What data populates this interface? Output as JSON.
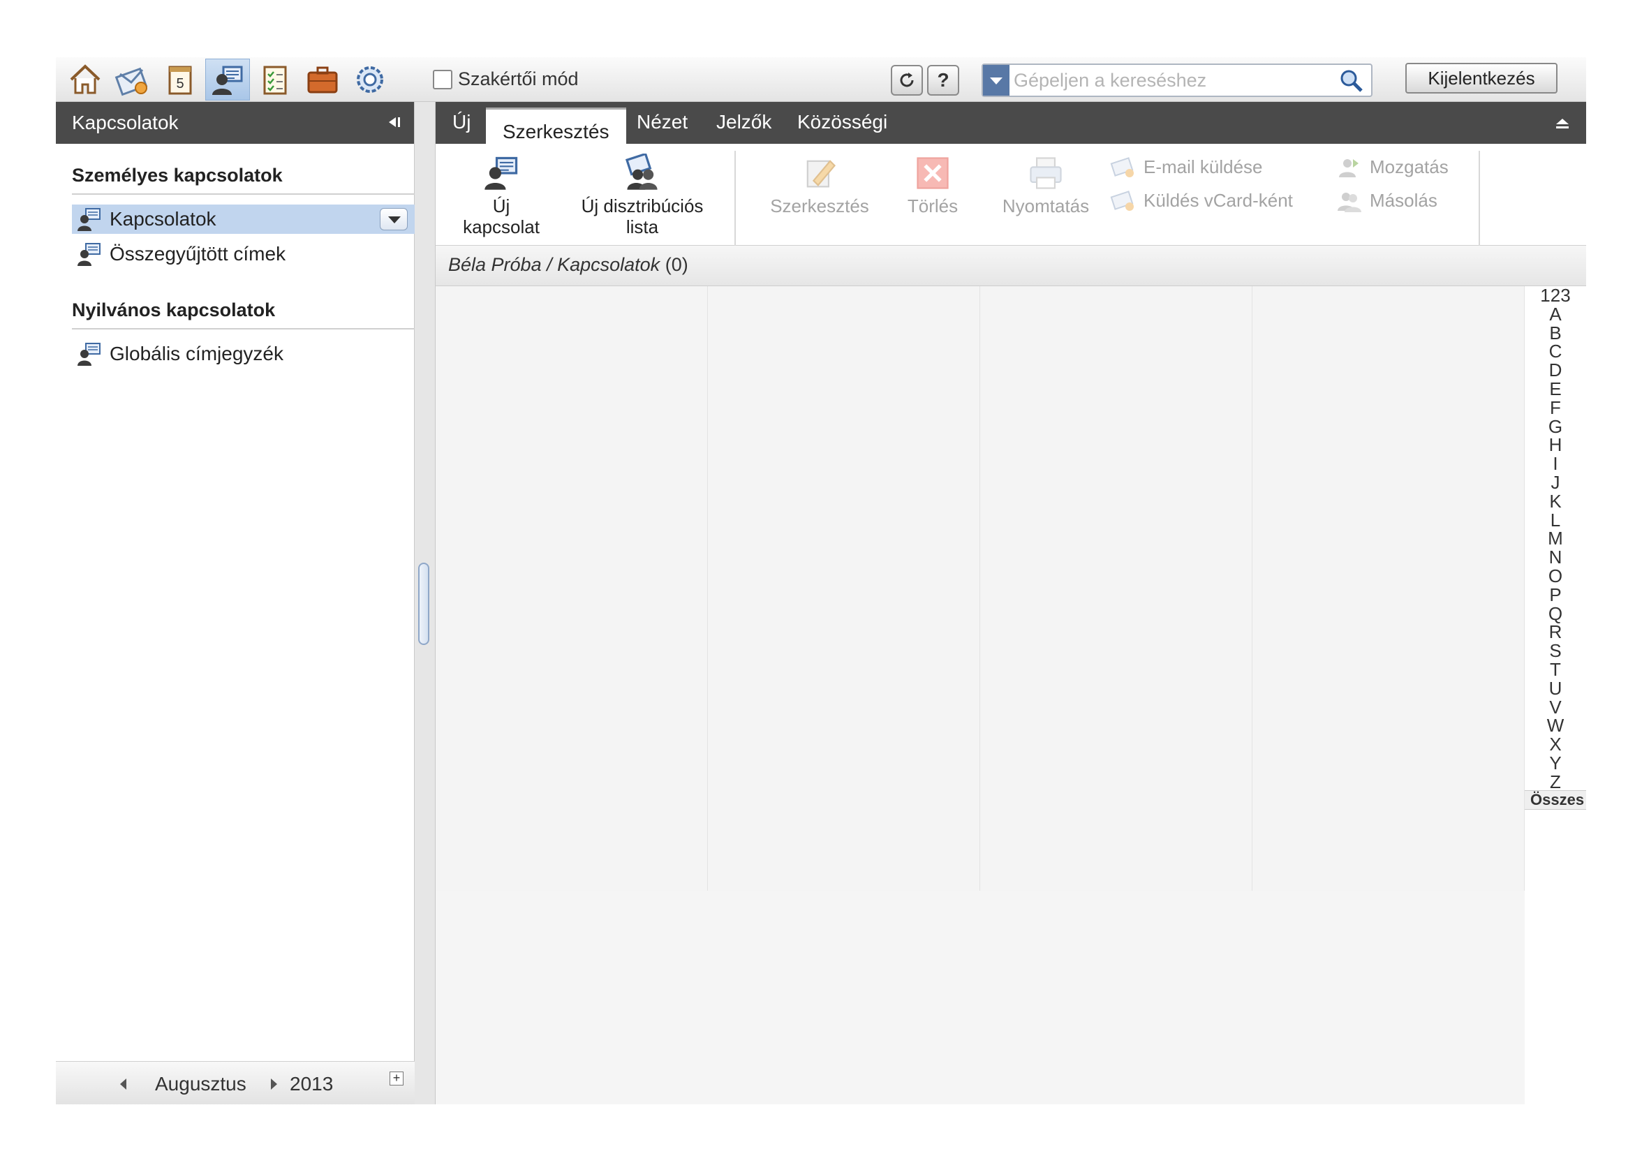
{
  "toolbar": {
    "apps": [
      {
        "name": "home-icon"
      },
      {
        "name": "mail-icon"
      },
      {
        "name": "calendar-icon",
        "day": "5"
      },
      {
        "name": "contacts-icon",
        "active": true
      },
      {
        "name": "tasks-icon"
      },
      {
        "name": "briefcase-icon"
      },
      {
        "name": "settings-icon"
      }
    ],
    "expert_mode_label": "Szakértői mód",
    "search_placeholder": "Gépeljen a kereséshez",
    "logout_label": "Kijelentkezés"
  },
  "sidebar": {
    "title": "Kapcsolatok",
    "personal_section": "Személyes kapcsolatok",
    "personal_items": [
      {
        "label": "Kapcsolatok",
        "selected": true
      },
      {
        "label": "Összegyűjtött címek"
      }
    ],
    "public_section": "Nyilvános kapcsolatok",
    "public_items": [
      {
        "label": "Globális címjegyzék"
      }
    ],
    "calendar": {
      "month": "Augusztus",
      "year": "2013"
    }
  },
  "ribbon": {
    "tabs": [
      "Új",
      "Szerkesztés",
      "Nézet",
      "Jelzők",
      "Közösségi"
    ],
    "active_tab": "Szerkesztés",
    "new_contact": [
      "Új",
      "kapcsolat"
    ],
    "new_dist_list": [
      "Új disztribúciós",
      "lista"
    ],
    "edit": "Szerkesztés",
    "delete": "Törlés",
    "print": "Nyomtatás",
    "send_email": "E-mail küldése",
    "send_vcard": "Küldés vCard-ként",
    "move": "Mozgatás",
    "copy": "Másolás"
  },
  "breadcrumb": {
    "path": "Béla Próba / Kapcsolatok",
    "count": "(0)"
  },
  "alphabet": {
    "letters": [
      "123",
      "A",
      "B",
      "C",
      "D",
      "E",
      "F",
      "G",
      "H",
      "I",
      "J",
      "K",
      "L",
      "M",
      "N",
      "O",
      "P",
      "Q",
      "R",
      "S",
      "T",
      "U",
      "V",
      "W",
      "X",
      "Y",
      "Z"
    ],
    "all_label": "Összes"
  },
  "colors": {
    "header_dark": "#4a4a4a",
    "selection": "#c1d5ee",
    "accent": "#5878a6"
  }
}
